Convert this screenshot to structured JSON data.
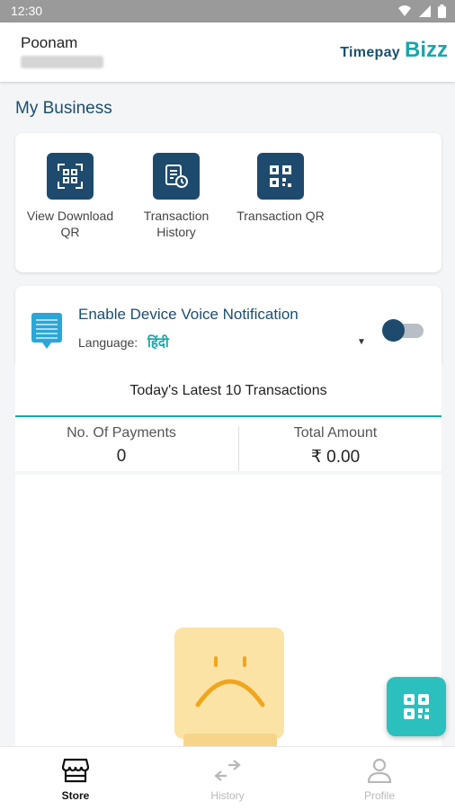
{
  "status_bar": {
    "time": "12:30",
    "icons": [
      "wifi-icon",
      "signal-icon",
      "battery-icon"
    ]
  },
  "header": {
    "user_name": "Poonam",
    "logo_timepay": "Timepay",
    "logo_bizz": "Bizz"
  },
  "section_title": "My Business",
  "quick_actions": [
    {
      "label": "View Download QR",
      "icon": "qr-scan-icon"
    },
    {
      "label": "Transaction History",
      "icon": "transaction-history-icon"
    },
    {
      "label": "Transaction QR",
      "icon": "qr-code-icon"
    }
  ],
  "voice_notification": {
    "title": "Enable Device Voice Notification",
    "language_label": "Language:",
    "language_value": "हिंदी",
    "enabled": false
  },
  "transactions": {
    "title": "Today's Latest 10 Transactions",
    "payments_label": "No. Of Payments",
    "payments_value": "0",
    "amount_label": "Total Amount",
    "amount_value": "₹ 0.00"
  },
  "bottom_nav": [
    {
      "label": "Store",
      "icon": "store-icon",
      "active": true
    },
    {
      "label": "History",
      "icon": "history-icon",
      "active": false
    },
    {
      "label": "Profile",
      "icon": "profile-icon",
      "active": false
    }
  ],
  "colors": {
    "primary": "#1e4a6d",
    "accent": "#1aa5a8",
    "fab": "#2bc0bd",
    "empty_face": "#fbe3a6"
  }
}
